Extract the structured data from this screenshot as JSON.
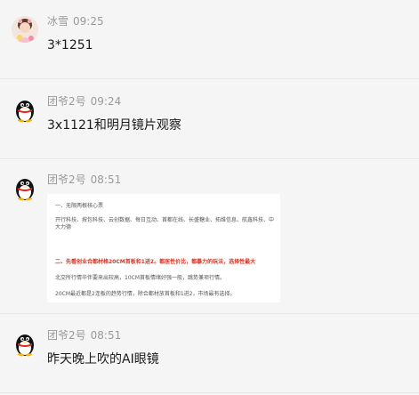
{
  "messages": [
    {
      "sender": "冰雪",
      "time": "09:25",
      "text": "3*1251",
      "avatar_icon": "flower-girl-avatar-icon"
    },
    {
      "sender": "团爷2号",
      "time": "09:24",
      "text": "3x1121和明月镜片观察",
      "avatar_icon": "qq-penguin-avatar-icon"
    },
    {
      "sender": "团爷2号",
      "time": "08:51",
      "avatar_icon": "qq-penguin-avatar-icon",
      "image_doc": {
        "line1": "一、无限两根核心票",
        "line2": "开行科技、按包科技、云创数据、每日互动、首都在线、长盛糖业、拓维信息、航鑫科技、中大力德",
        "line3": "二、先看创业合都材格20CM首板和1进2。都居性价比，都暴力的玩法，选择性最大",
        "line4": "北交所行情毕伴要来出较高，10CM首板情绪好强一般，跳势兼项行情。",
        "line5": "20CM最近都是2连板的趋势行情，除合都材放首板和1进2，市场最有选择。"
      }
    },
    {
      "sender": "团爷2号",
      "time": "08:51",
      "text": "昨天晚上吹的AI眼镜",
      "avatar_icon": "qq-penguin-avatar-icon"
    }
  ],
  "colors": {
    "background": "#f5f5f5",
    "meta_text": "#9a9a9a",
    "message_text": "#1a1a1a",
    "doc_red": "#e0301e"
  }
}
